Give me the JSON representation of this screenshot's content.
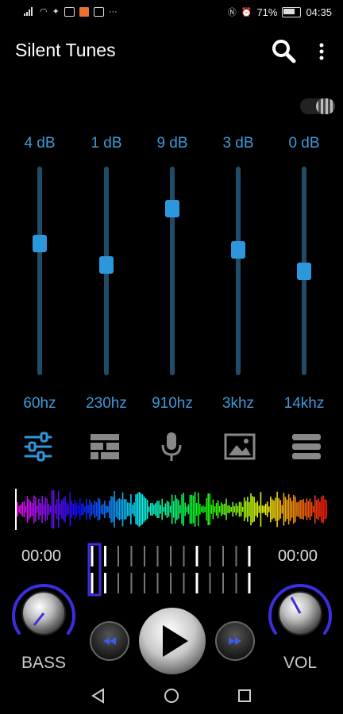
{
  "status_bar": {
    "battery_percent": "71%",
    "time": "04:35"
  },
  "app": {
    "title": "Silent Tunes"
  },
  "icons": {
    "search": "search-icon",
    "more": "more-vert-icon"
  },
  "equalizer": {
    "bands": [
      {
        "db_label": "4 dB",
        "freq_label": "60hz",
        "level": 0.37
      },
      {
        "db_label": "1 dB",
        "freq_label": "230hz",
        "level": 0.47
      },
      {
        "db_label": "9 dB",
        "freq_label": "910hz",
        "level": 0.2
      },
      {
        "db_label": "3 dB",
        "freq_label": "3khz",
        "level": 0.4
      },
      {
        "db_label": "0 dB",
        "freq_label": "14khz",
        "level": 0.5
      }
    ]
  },
  "tabs": [
    "equalizer-icon",
    "preset-blocks-icon",
    "microphone-icon",
    "image-icon",
    "list-icon"
  ],
  "player": {
    "elapsed": "00:00",
    "duration": "00:00",
    "bass_label": "BASS",
    "vol_label": "VOL"
  },
  "colors": {
    "accent": "#2d97dd",
    "text_blue": "#3d9ad8",
    "ring": "#3b2ee0"
  }
}
